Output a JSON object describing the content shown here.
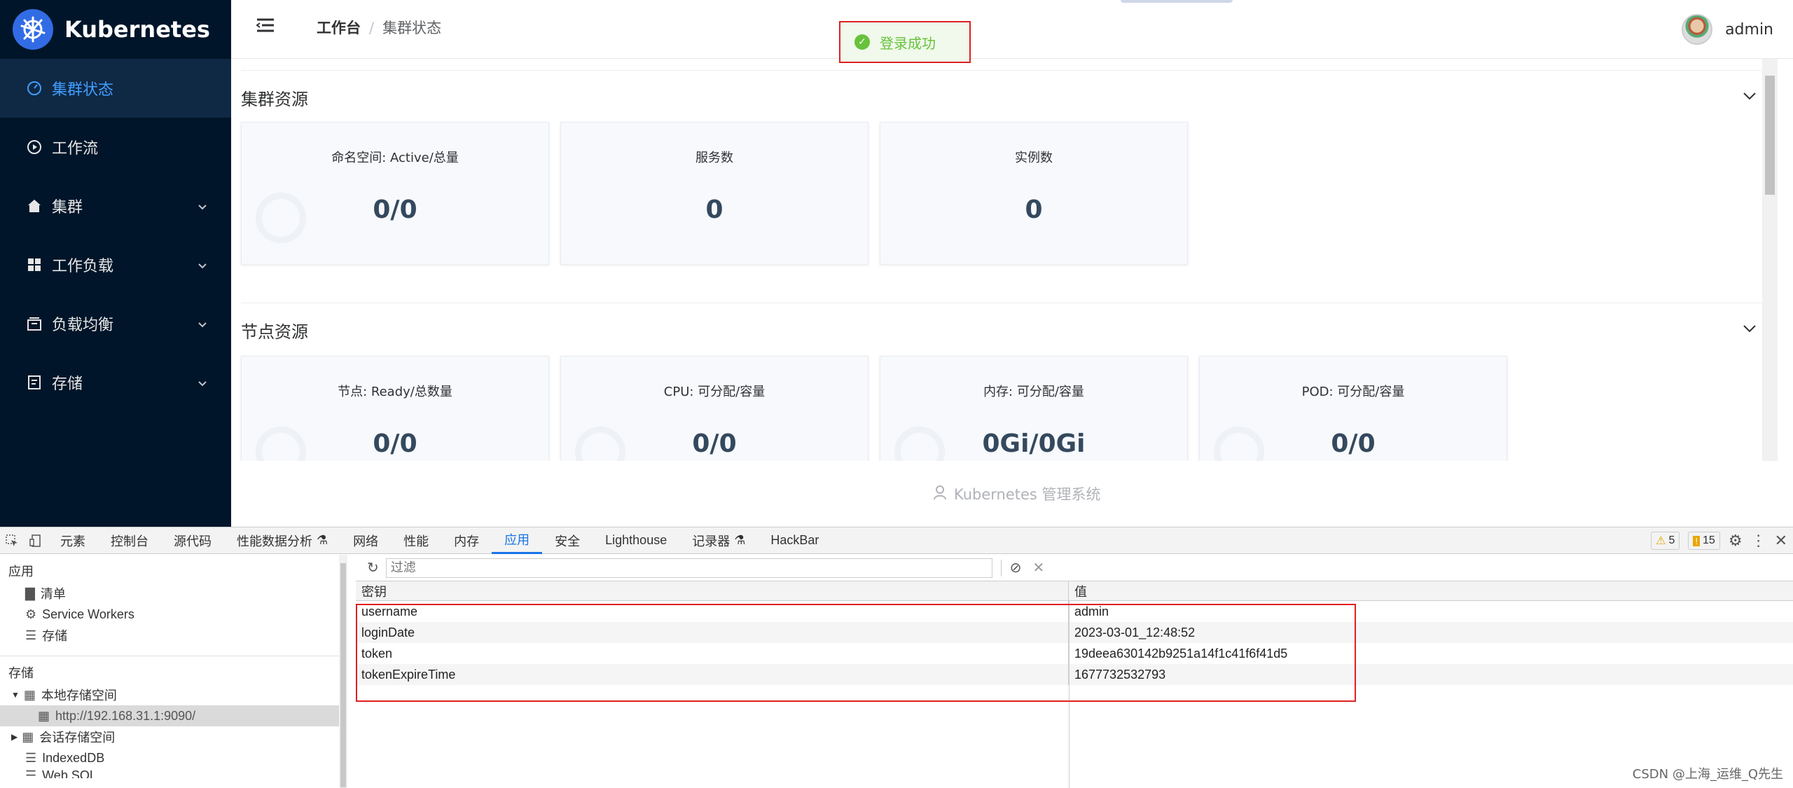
{
  "app": {
    "brand": "Kubernetes",
    "user_name": "admin",
    "footer_text": "Kubernetes 管理系统",
    "accent_color": "#409eff",
    "sidebar_bg": "#001529"
  },
  "sidebar": {
    "items": [
      {
        "label": "集群状态",
        "icon": "dashboard-icon",
        "active": true
      },
      {
        "label": "工作流",
        "icon": "play-circle-icon"
      },
      {
        "label": "集群",
        "icon": "home-icon",
        "expandable": true
      },
      {
        "label": "工作负载",
        "icon": "grid-icon",
        "expandable": true
      },
      {
        "label": "负载均衡",
        "icon": "box-icon",
        "expandable": true
      },
      {
        "label": "存储",
        "icon": "document-icon",
        "expandable": true
      }
    ]
  },
  "breadcrumb": {
    "home": "工作台",
    "current": "集群状态"
  },
  "toast": {
    "message": "登录成功",
    "type": "success"
  },
  "sections": [
    {
      "title": "集群资源",
      "cards": [
        {
          "label": "命名空间: Active/总量",
          "value": "0/0"
        },
        {
          "label": "服务数",
          "value": "0"
        },
        {
          "label": "实例数",
          "value": "0"
        }
      ]
    },
    {
      "title": "节点资源",
      "cards": [
        {
          "label": "节点: Ready/总数量",
          "value": "0/0"
        },
        {
          "label": "CPU: 可分配/容量",
          "value": "0/0"
        },
        {
          "label": "内存: 可分配/容量",
          "value": "0Gi/0Gi"
        },
        {
          "label": "POD: 可分配/容量",
          "value": "0/0"
        }
      ]
    }
  ],
  "devtools": {
    "tabs": [
      "元素",
      "控制台",
      "源代码",
      "性能数据分析",
      "网络",
      "性能",
      "内存",
      "应用",
      "安全",
      "Lighthouse",
      "记录器",
      "HackBar"
    ],
    "active_tab": "应用",
    "warnings": "5",
    "issues": "15",
    "left": {
      "section_app": "应用",
      "app_items": [
        "清单",
        "Service Workers",
        "存储"
      ],
      "section_storage": "存储",
      "local_storage": "本地存储空间",
      "local_origin": "http://192.168.31.1:9090/",
      "session_storage": "会话存储空间",
      "indexeddb": "IndexedDB",
      "websql": "Web SQL"
    },
    "filter_placeholder": "过滤",
    "grid": {
      "col_key": "密钥",
      "col_value": "值",
      "rows": [
        {
          "key": "username",
          "value": "admin"
        },
        {
          "key": "loginDate",
          "value": "2023-03-01_12:48:52"
        },
        {
          "key": "token",
          "value": "19deea630142b9251a14f1c41f6f41d5"
        },
        {
          "key": "tokenExpireTime",
          "value": "1677732532793"
        }
      ]
    }
  },
  "watermark": "CSDN @上海_运维_Q先生"
}
